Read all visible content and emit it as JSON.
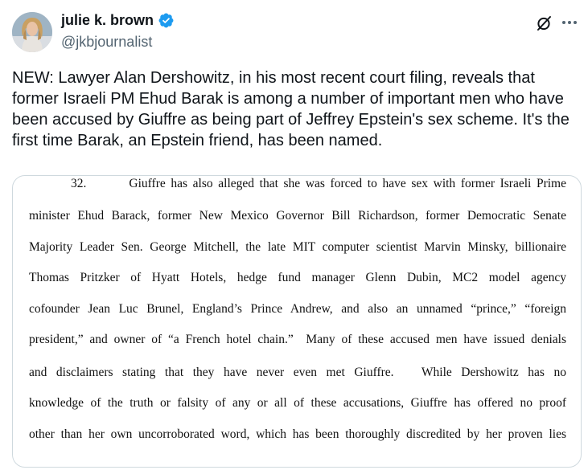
{
  "author": {
    "display_name": "julie k. brown",
    "handle": "@jkbjournalist"
  },
  "icons": {
    "verified": "verified-badge-icon",
    "grok": "grok-icon",
    "more": "more-options-icon",
    "verified_color": "#1d9bf0"
  },
  "tweet": {
    "text": "NEW: Lawyer Alan Dershowitz, in his most recent court filing, reveals that former Israeli PM Ehud Barak is among a number of important men who have been accused by Giuffre as being part of Jeffrey Epstein's sex scheme. It's the first time Barak, an Epstein friend, has been named."
  },
  "document": {
    "lines": [
      "32.        Giuffre has also alleged that she was forced to have sex with former Israeli Prime",
      "minister Ehud Barack, former New Mexico Governor Bill Richardson, former Democratic Senate",
      "Majority Leader Sen. George Mitchell, the late MIT computer scientist Marvin Minsky, billionaire",
      "Thomas Pritzker of Hyatt Hotels, hedge fund manager Glenn Dubin, MC2 model agency",
      "cofounder Jean Luc Brunel, England’s Prince Andrew, and also an unnamed “prince,” “foreign",
      "president,” and owner of “a French hotel chain.”  Many of these accused men have issued denials",
      "and disclaimers stating that they have never even met Giuffre.   While Dershowitz has no",
      "knowledge of the truth or falsity of any or all of these accusations, Giuffre has offered no proof",
      "other than her own uncorroborated word, which has been thoroughly discredited by her proven lies"
    ]
  }
}
